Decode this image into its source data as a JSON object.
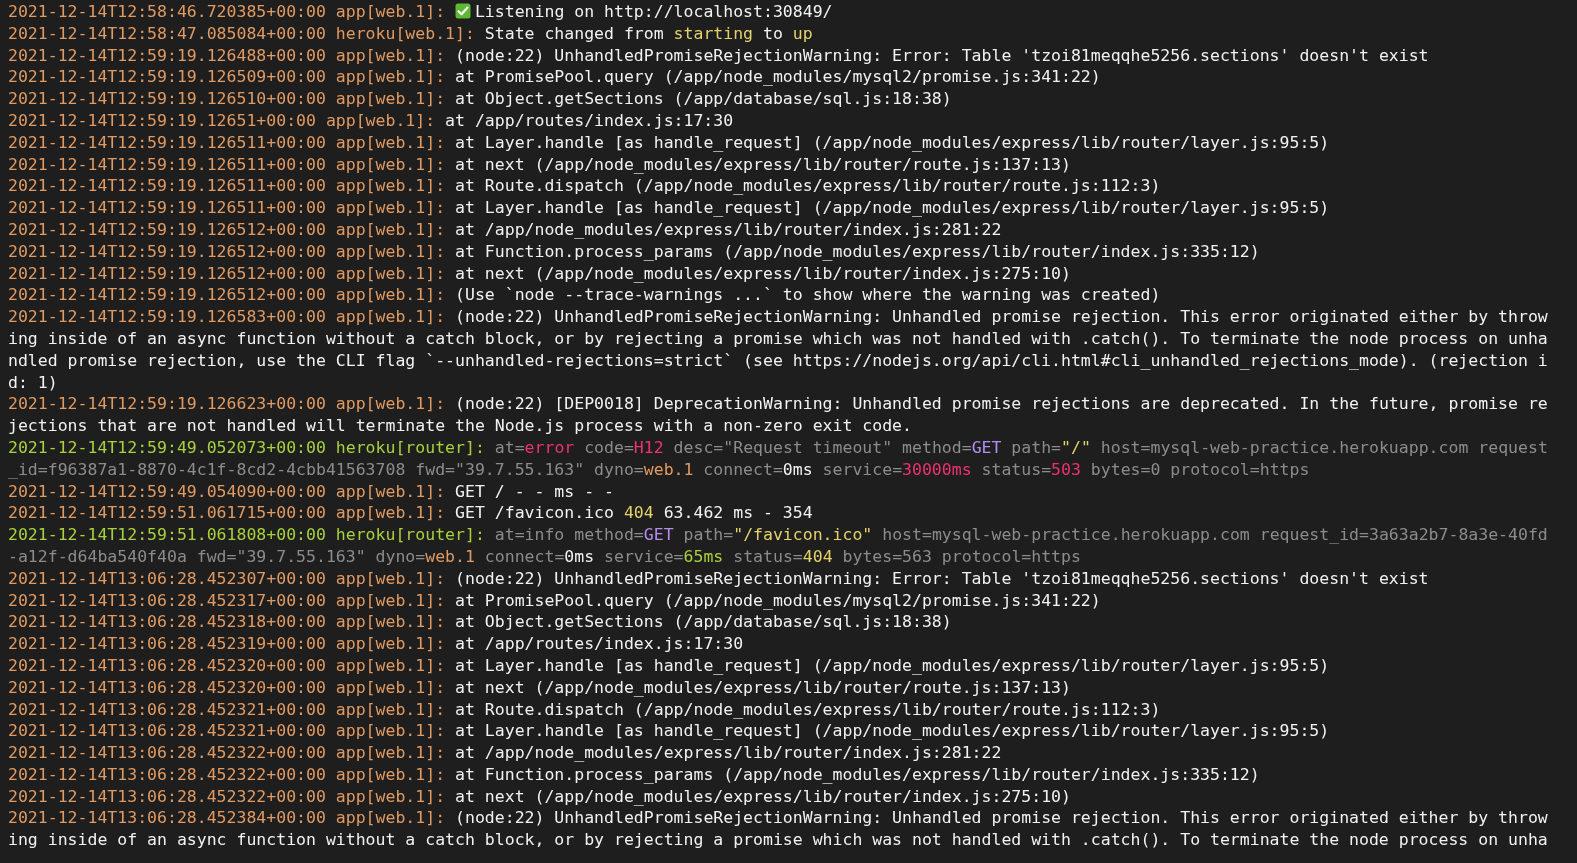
{
  "log_lines": [
    {
      "timestamp": "2021-12-14T12:58:46.720385+00:00",
      "source": "app[web.1]:",
      "kind": "check",
      "message": "Listening on http://localhost:30849/"
    },
    {
      "timestamp": "2021-12-14T12:58:47.085084+00:00",
      "source": "heroku[web.1]:",
      "kind": "app",
      "parts": [
        {
          "kind": "plain",
          "text": "State changed from "
        },
        {
          "kind": "yellow",
          "text": "starting"
        },
        {
          "kind": "plain",
          "text": " to "
        },
        {
          "kind": "yellow",
          "text": "up"
        }
      ]
    },
    {
      "timestamp": "2021-12-14T12:59:19.126488+00:00",
      "source": "app[web.1]:",
      "kind": "app",
      "message": "(node:22) UnhandledPromiseRejectionWarning: Error: Table 'tzoi81meqqhe5256.sections' doesn't exist"
    },
    {
      "timestamp": "2021-12-14T12:59:19.126509+00:00",
      "source": "app[web.1]:",
      "kind": "app",
      "message": "at PromisePool.query (/app/node_modules/mysql2/promise.js:341:22)"
    },
    {
      "timestamp": "2021-12-14T12:59:19.126510+00:00",
      "source": "app[web.1]:",
      "kind": "app",
      "message": "at Object.getSections (/app/database/sql.js:18:38)"
    },
    {
      "timestamp": "2021-12-14T12:59:19.12651+00:00",
      "source": "app[web.1]:",
      "kind": "app",
      "message": "at /app/routes/index.js:17:30"
    },
    {
      "timestamp": "2021-12-14T12:59:19.126511+00:00",
      "source": "app[web.1]:",
      "kind": "app",
      "message": "at Layer.handle [as handle_request] (/app/node_modules/express/lib/router/layer.js:95:5)"
    },
    {
      "timestamp": "2021-12-14T12:59:19.126511+00:00",
      "source": "app[web.1]:",
      "kind": "app",
      "message": "at next (/app/node_modules/express/lib/router/route.js:137:13)"
    },
    {
      "timestamp": "2021-12-14T12:59:19.126511+00:00",
      "source": "app[web.1]:",
      "kind": "app",
      "message": "at Route.dispatch (/app/node_modules/express/lib/router/route.js:112:3)"
    },
    {
      "timestamp": "2021-12-14T12:59:19.126511+00:00",
      "source": "app[web.1]:",
      "kind": "app",
      "message": "at Layer.handle [as handle_request] (/app/node_modules/express/lib/router/layer.js:95:5)"
    },
    {
      "timestamp": "2021-12-14T12:59:19.126512+00:00",
      "source": "app[web.1]:",
      "kind": "app",
      "message": "at /app/node_modules/express/lib/router/index.js:281:22"
    },
    {
      "timestamp": "2021-12-14T12:59:19.126512+00:00",
      "source": "app[web.1]:",
      "kind": "app",
      "message": "at Function.process_params (/app/node_modules/express/lib/router/index.js:335:12)"
    },
    {
      "timestamp": "2021-12-14T12:59:19.126512+00:00",
      "source": "app[web.1]:",
      "kind": "app",
      "message": "at next (/app/node_modules/express/lib/router/index.js:275:10)"
    },
    {
      "timestamp": "2021-12-14T12:59:19.126512+00:00",
      "source": "app[web.1]:",
      "kind": "app",
      "message": "(Use `node --trace-warnings ...` to show where the warning was created)"
    },
    {
      "timestamp": "2021-12-14T12:59:19.126583+00:00",
      "source": "app[web.1]:",
      "kind": "app",
      "message": "(node:22) UnhandledPromiseRejectionWarning: Unhandled promise rejection. This error originated either by throwing inside of an async function without a catch block, or by rejecting a promise which was not handled with .catch(). To terminate the node process on unhandled promise rejection, use the CLI flag `--unhandled-rejections=strict` (see https://nodejs.org/api/cli.html#cli_unhandled_rejections_mode). (rejection id: 1)"
    },
    {
      "timestamp": "2021-12-14T12:59:19.126623+00:00",
      "source": "app[web.1]:",
      "kind": "app",
      "message": "(node:22) [DEP0018] DeprecationWarning: Unhandled promise rejections are deprecated. In the future, promise rejections that are not handled will terminate the Node.js process with a non-zero exit code."
    },
    {
      "timestamp": "2021-12-14T12:59:49.052073+00:00",
      "source": "heroku[router]:",
      "kind": "router",
      "parts": [
        {
          "kind": "dim",
          "text": "at="
        },
        {
          "kind": "red",
          "text": "error"
        },
        {
          "kind": "dim",
          "text": " code="
        },
        {
          "kind": "red",
          "text": "H12"
        },
        {
          "kind": "dim",
          "text": " desc=\"Request timeout\" method="
        },
        {
          "kind": "purple",
          "text": "GET"
        },
        {
          "kind": "dim",
          "text": " path="
        },
        {
          "kind": "yellow",
          "text": "\"/\""
        },
        {
          "kind": "dim",
          "text": " host=mysql-web-practice.herokuapp.com request_id=f96387a1-8870-4c1f-8cd2-4cbb41563708 fwd=\"39.7.55.163\" dyno="
        },
        {
          "kind": "orange",
          "text": "web.1"
        },
        {
          "kind": "dim",
          "text": " connect="
        },
        {
          "kind": "plain",
          "text": "0ms"
        },
        {
          "kind": "dim",
          "text": " service="
        },
        {
          "kind": "red",
          "text": "30000ms"
        },
        {
          "kind": "dim",
          "text": " status="
        },
        {
          "kind": "red",
          "text": "503"
        },
        {
          "kind": "dim",
          "text": " bytes=0 protocol=https"
        }
      ]
    },
    {
      "timestamp": "2021-12-14T12:59:49.054090+00:00",
      "source": "app[web.1]:",
      "kind": "app",
      "message": "GET / - - ms - -"
    },
    {
      "timestamp": "2021-12-14T12:59:51.061715+00:00",
      "source": "app[web.1]:",
      "kind": "app",
      "parts": [
        {
          "kind": "plain",
          "text": "GET /favicon.ico "
        },
        {
          "kind": "yellow",
          "text": "404"
        },
        {
          "kind": "plain",
          "text": " 63.462 ms - 354"
        }
      ]
    },
    {
      "timestamp": "2021-12-14T12:59:51.061808+00:00",
      "source": "heroku[router]:",
      "kind": "router",
      "parts": [
        {
          "kind": "dim",
          "text": "at=info method="
        },
        {
          "kind": "purple",
          "text": "GET"
        },
        {
          "kind": "dim",
          "text": " path="
        },
        {
          "kind": "yellow",
          "text": "\"/favicon.ico\""
        },
        {
          "kind": "dim",
          "text": " host=mysql-web-practice.herokuapp.com request_id=3a63a2b7-8a3e-40fd-a12f-d64ba540f40a fwd=\"39.7.55.163\" dyno="
        },
        {
          "kind": "orange",
          "text": "web.1"
        },
        {
          "kind": "dim",
          "text": " connect="
        },
        {
          "kind": "plain",
          "text": "0ms"
        },
        {
          "kind": "dim",
          "text": " service="
        },
        {
          "kind": "green",
          "text": "65ms"
        },
        {
          "kind": "dim",
          "text": " status="
        },
        {
          "kind": "yellow",
          "text": "404"
        },
        {
          "kind": "dim",
          "text": " bytes=563 protocol=https"
        }
      ]
    },
    {
      "timestamp": "2021-12-14T13:06:28.452307+00:00",
      "source": "app[web.1]:",
      "kind": "app",
      "message": "(node:22) UnhandledPromiseRejectionWarning: Error: Table 'tzoi81meqqhe5256.sections' doesn't exist"
    },
    {
      "timestamp": "2021-12-14T13:06:28.452317+00:00",
      "source": "app[web.1]:",
      "kind": "app",
      "message": "at PromisePool.query (/app/node_modules/mysql2/promise.js:341:22)"
    },
    {
      "timestamp": "2021-12-14T13:06:28.452318+00:00",
      "source": "app[web.1]:",
      "kind": "app",
      "message": "at Object.getSections (/app/database/sql.js:18:38)"
    },
    {
      "timestamp": "2021-12-14T13:06:28.452319+00:00",
      "source": "app[web.1]:",
      "kind": "app",
      "message": "at /app/routes/index.js:17:30"
    },
    {
      "timestamp": "2021-12-14T13:06:28.452320+00:00",
      "source": "app[web.1]:",
      "kind": "app",
      "message": "at Layer.handle [as handle_request] (/app/node_modules/express/lib/router/layer.js:95:5)"
    },
    {
      "timestamp": "2021-12-14T13:06:28.452320+00:00",
      "source": "app[web.1]:",
      "kind": "app",
      "message": "at next (/app/node_modules/express/lib/router/route.js:137:13)"
    },
    {
      "timestamp": "2021-12-14T13:06:28.452321+00:00",
      "source": "app[web.1]:",
      "kind": "app",
      "message": "at Route.dispatch (/app/node_modules/express/lib/router/route.js:112:3)"
    },
    {
      "timestamp": "2021-12-14T13:06:28.452321+00:00",
      "source": "app[web.1]:",
      "kind": "app",
      "message": "at Layer.handle [as handle_request] (/app/node_modules/express/lib/router/layer.js:95:5)"
    },
    {
      "timestamp": "2021-12-14T13:06:28.452322+00:00",
      "source": "app[web.1]:",
      "kind": "app",
      "message": "at /app/node_modules/express/lib/router/index.js:281:22"
    },
    {
      "timestamp": "2021-12-14T13:06:28.452322+00:00",
      "source": "app[web.1]:",
      "kind": "app",
      "message": "at Function.process_params (/app/node_modules/express/lib/router/index.js:335:12)"
    },
    {
      "timestamp": "2021-12-14T13:06:28.452322+00:00",
      "source": "app[web.1]:",
      "kind": "app",
      "message": "at next (/app/node_modules/express/lib/router/index.js:275:10)"
    },
    {
      "timestamp": "2021-12-14T13:06:28.452384+00:00",
      "source": "app[web.1]:",
      "kind": "app",
      "message": "(node:22) UnhandledPromiseRejectionWarning: Unhandled promise rejection. This error originated either by throwing inside of an async function without a catch block, or by rejecting a promise which was not handled with .catch(). To terminate the node process on unha"
    }
  ]
}
